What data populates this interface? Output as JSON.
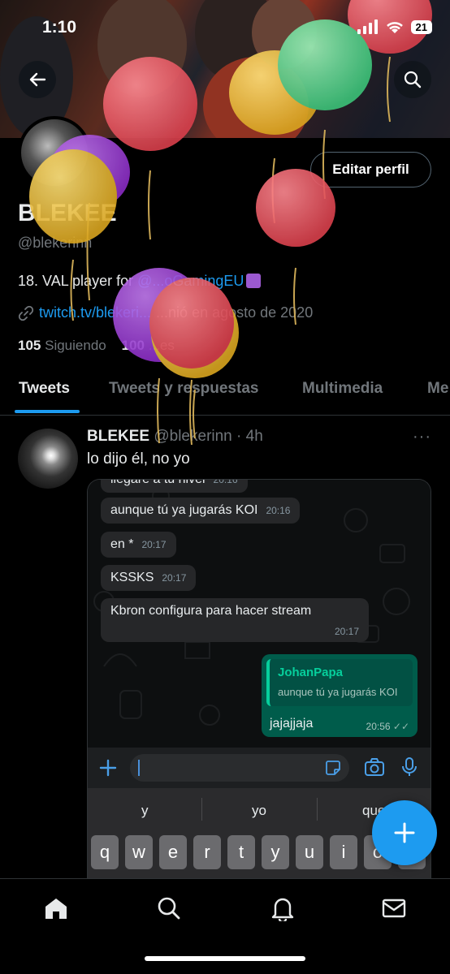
{
  "status_bar": {
    "time": "1:10",
    "battery": "21"
  },
  "profile": {
    "name": "BLEKEE",
    "handle": "@blekerinn",
    "bio_prefix": "18. VAL player for ",
    "bio_mention": "@...oGamingEU",
    "link": "twitch.tv/blekeri...",
    "joined": "...nió en agosto de 2020",
    "following_count": "105",
    "following_label": "Siguiendo",
    "followers_count": "100",
    "followers_label": "...es",
    "edit_button": "Editar perfil"
  },
  "tabs": [
    {
      "label": "Tweets"
    },
    {
      "label": "Tweets y respuestas"
    },
    {
      "label": "Multimedia"
    },
    {
      "label": "Me"
    }
  ],
  "tweet": {
    "name": "BLEKEE",
    "meta": "@blekerinn · 4h",
    "text": "lo dijo él, no yo",
    "more": "···"
  },
  "chat": {
    "messages": [
      {
        "text": "llegaré a tu nivel",
        "time": "20:16"
      },
      {
        "text": "aunque tú ya jugarás KOI",
        "time": "20:16"
      },
      {
        "text": "en *",
        "time": "20:17"
      },
      {
        "text": "KSSKS",
        "time": "20:17"
      },
      {
        "text": "Kbron configura para hacer stream",
        "time": "20:17"
      }
    ],
    "reply": {
      "quoted_name": "JohanPapa",
      "quoted_text": "aunque tú ya jugarás KOI",
      "text": "jajajjaja",
      "time": "20:56"
    }
  },
  "keyboard": {
    "suggestions": [
      "y",
      "yo",
      "que"
    ],
    "keys": [
      "q",
      "w",
      "e",
      "r",
      "t",
      "y",
      "u",
      "i",
      "o",
      "p"
    ]
  },
  "colors": {
    "accent": "#1d9bf0",
    "balloon_red": "#e8555f",
    "balloon_yellow": "#e6b83a",
    "balloon_green": "#4fd68a",
    "balloon_purple": "#9b3fd0"
  }
}
